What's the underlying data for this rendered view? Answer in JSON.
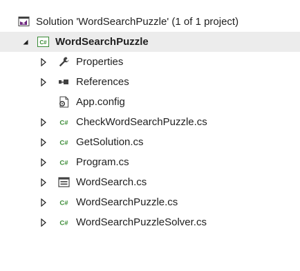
{
  "solution": {
    "label": "Solution 'WordSearchPuzzle' (1 of 1 project)",
    "icon": "solution-icon"
  },
  "project": {
    "label": "WordSearchPuzzle",
    "icon": "csharp-project-icon",
    "expanded": true
  },
  "items": [
    {
      "label": "Properties",
      "icon": "wrench-icon",
      "expandable": true
    },
    {
      "label": "References",
      "icon": "references-icon",
      "expandable": true
    },
    {
      "label": "App.config",
      "icon": "config-file-icon",
      "expandable": false
    },
    {
      "label": "CheckWordSearchPuzzle.cs",
      "icon": "csharp-file-icon",
      "expandable": true
    },
    {
      "label": "GetSolution.cs",
      "icon": "csharp-file-icon",
      "expandable": true
    },
    {
      "label": "Program.cs",
      "icon": "csharp-file-icon",
      "expandable": true
    },
    {
      "label": "WordSearch.cs",
      "icon": "form-icon",
      "expandable": true
    },
    {
      "label": "WordSearchPuzzle.cs",
      "icon": "csharp-file-icon",
      "expandable": true
    },
    {
      "label": "WordSearchPuzzleSolver.cs",
      "icon": "csharp-file-icon",
      "expandable": true
    }
  ],
  "colors": {
    "csharp_green": "#388a34",
    "solution_purple": "#68217a",
    "text": "#1e1e1e",
    "selected_bg": "#ececec"
  }
}
